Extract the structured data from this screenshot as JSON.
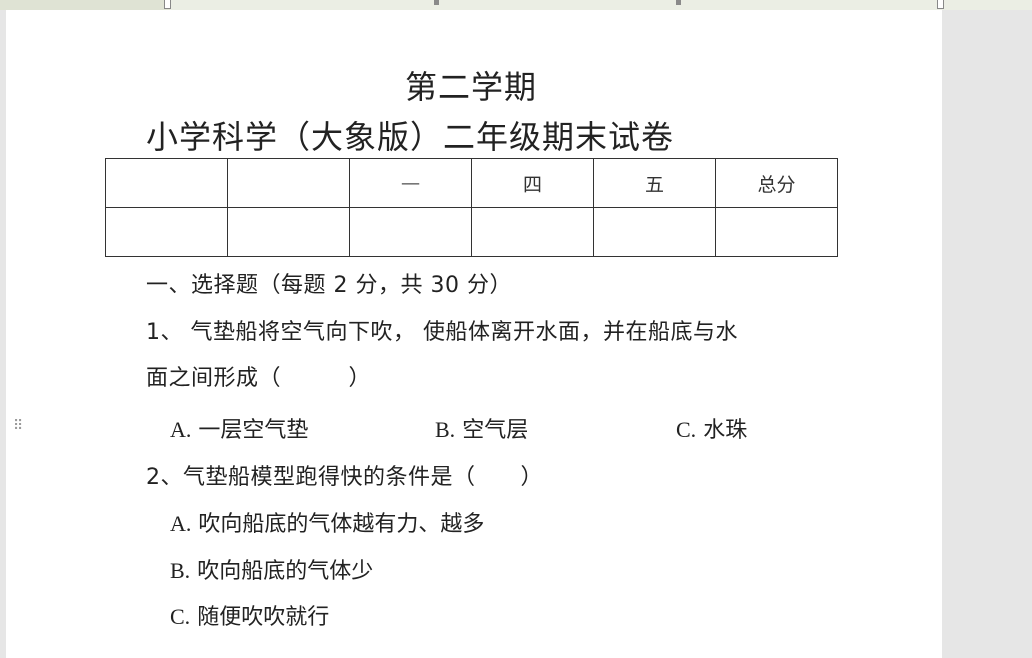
{
  "document": {
    "title_line1": "第二学期",
    "title_line2": "小学科学（大象版）二年级期末试卷",
    "score_table": {
      "header": [
        "",
        "",
        "一",
        "四",
        "五",
        "总分"
      ],
      "row2": [
        "",
        "",
        "",
        "",
        "",
        ""
      ]
    },
    "section1_heading": "一、选择题（每题 2 分，共 30 分）",
    "q1_line1": "1、 气垫船将空气向下吹， 使船体离开水面，并在船底与水",
    "q1_line2": "面之间形成（　　　）",
    "q1_options": [
      {
        "letter": "A.",
        "text": "一层空气垫"
      },
      {
        "letter": "B.",
        "text": "空气层"
      },
      {
        "letter": "C.",
        "text": "水珠"
      }
    ],
    "q2_line": "2、气垫船模型跑得快的条件是（　　）",
    "q2_options": [
      {
        "letter": "A.",
        "text": "吹向船底的气体越有力、越多"
      },
      {
        "letter": "B.",
        "text": "吹向船底的气体少"
      },
      {
        "letter": "C.",
        "text": "随便吹吹就行"
      }
    ]
  }
}
